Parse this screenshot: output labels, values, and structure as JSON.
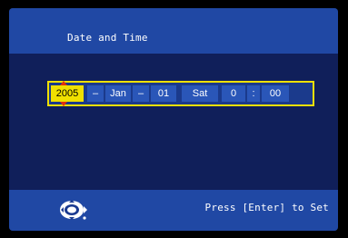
{
  "window": {
    "title": "Date and Time"
  },
  "date_time": {
    "year": "2005",
    "dash1": "–",
    "month": "Jan",
    "dash2": "–",
    "day": "01",
    "weekday": "Sat",
    "hour": "0",
    "colon": ":",
    "minute": "00",
    "active_field": "year"
  },
  "footer": {
    "control_icon": "joystick-icon",
    "hint": "Press [Enter] to Set"
  },
  "colors": {
    "title_bar": "#2048a4",
    "background": "#101f5a",
    "highlight": "#f0e000",
    "arrow": "#e03010"
  }
}
